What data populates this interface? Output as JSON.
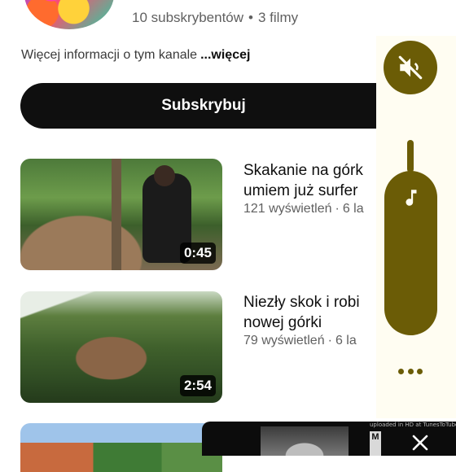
{
  "channel": {
    "subscribers": "10 subskrybentów",
    "separator": "•",
    "videos_count": "3 filmy",
    "description": "Więcej informacji o tym kanale",
    "more_link": "...więcej",
    "subscribe_label": "Subskrybuj"
  },
  "videos": [
    {
      "title_line1": "Skakanie na górk",
      "title_line2": "umiem już surfer",
      "views": "121 wyświetleń",
      "separator": "·",
      "age": "6 la",
      "duration": "0:45"
    },
    {
      "title_line1": "Niezły skok i robi",
      "title_line2": "nowej górki",
      "views": "79 wyświetleń",
      "separator": "·",
      "age": "6 la",
      "duration": "2:54"
    }
  ],
  "side_panel": {
    "accent_color": "#6b5c06",
    "mute_icon": "speaker-muted-icon",
    "music_icon": "music-note-icon",
    "more_icon": "more-dots-icon"
  },
  "mini_player": {
    "watermark": "uploaded in HD at TunesToTube.com",
    "side_letter": "M",
    "close_icon": "close-icon"
  }
}
